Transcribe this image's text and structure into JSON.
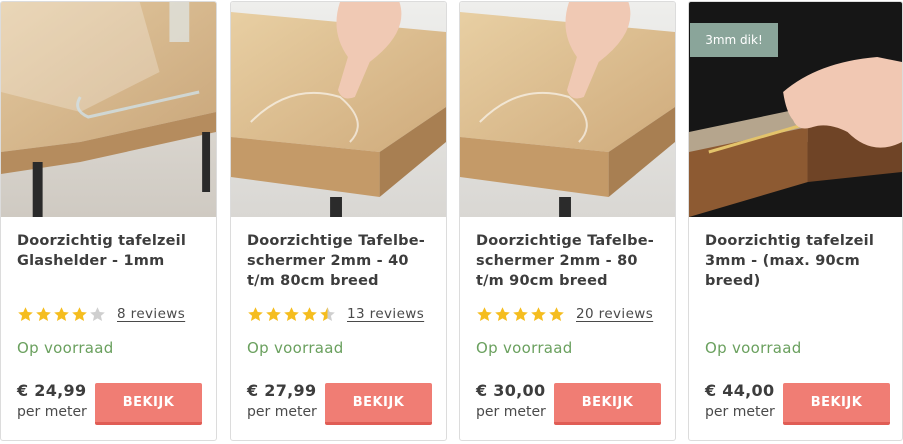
{
  "products": [
    {
      "title": "Doorzichtig tafelzeil Glashelder - 1mm",
      "rating": 4,
      "reviews": "8  reviews",
      "stock": "Op voorraad",
      "price": "€ 24,99",
      "unit": "per meter",
      "button": "BEKIJK",
      "badge": ""
    },
    {
      "title": "Doorzichtige Tafelbe-schermer 2mm - 40 t/m 80cm breed",
      "rating": 4.5,
      "reviews": "13  reviews",
      "stock": "Op voorraad",
      "price": "€ 27,99",
      "unit": "per meter",
      "button": "BEKIJK",
      "badge": ""
    },
    {
      "title": "Doorzichtige Tafelbe-schermer 2mm - 80 t/m 90cm breed",
      "rating": 5,
      "reviews": "20  reviews",
      "stock": "Op voorraad",
      "price": "€ 30,00",
      "unit": "per meter",
      "button": "BEKIJK",
      "badge": ""
    },
    {
      "title": "Doorzichtig tafelzeil 3mm - (max. 90cm breed)",
      "rating": null,
      "reviews": "",
      "stock": "Op voorraad",
      "price": "€ 44,00",
      "unit": "per meter",
      "button": "BEKIJK",
      "badge": "3mm dik!"
    }
  ],
  "icons": {
    "star": "star-icon"
  },
  "colors": {
    "star_filled": "#f5bd1f",
    "star_empty": "#cfcfcf",
    "stock": "#6aa05e",
    "button": "#f07d74",
    "badge": "#8aa59a"
  }
}
